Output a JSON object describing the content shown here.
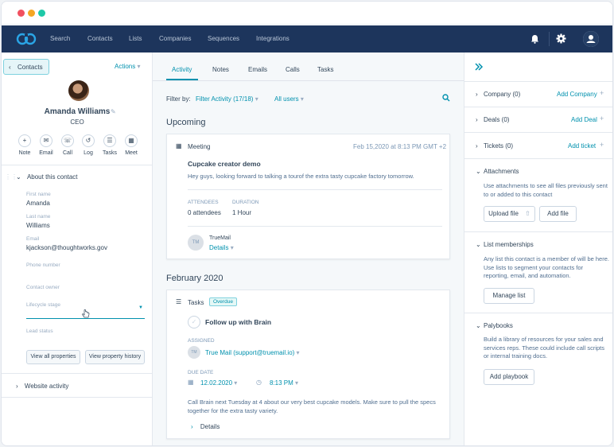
{
  "nav": {
    "items": [
      "Search",
      "Contacts",
      "Lists",
      "Companies",
      "Sequences",
      "Integrations"
    ]
  },
  "left": {
    "contacts_button": "Contacts",
    "actions": "Actions",
    "name": "Amanda Williams",
    "role": "CEO",
    "quick_actions": [
      "Note",
      "Email",
      "Call",
      "Log",
      "Tasks",
      "Meet"
    ],
    "about_title": "About this contact",
    "fields": [
      {
        "label": "First name",
        "value": "Amanda"
      },
      {
        "label": "Last name",
        "value": "Williams"
      },
      {
        "label": "Email",
        "value": "kjackson@thoughtworks.gov"
      },
      {
        "label": "Phone number",
        "value": ""
      },
      {
        "label": "Contact owner",
        "value": ""
      },
      {
        "label": "Lifecycle stage",
        "value": ""
      },
      {
        "label": "Lead status",
        "value": ""
      }
    ],
    "view_all": "View all properties",
    "view_history": "View property history",
    "website_activity": "Website activity"
  },
  "mid": {
    "tabs": [
      "Activity",
      "Notes",
      "Emails",
      "Calls",
      "Tasks"
    ],
    "filter_label": "Filter by:",
    "filter_activity": "Filter Activity (17/18)",
    "filter_users": "All users",
    "upcoming": "Upcoming",
    "meeting": {
      "type": "Meeting",
      "date": "Feb 15,2020 at 8:13 PM GMT +2",
      "title": "Cupcake creator demo",
      "body": "Hey guys, looking forward to talking a tourof the extra tasty cupcake factory tomorrow.",
      "attendees_label": "ATTENDEES",
      "attendees_value": "0 attendees",
      "duration_label": "DURATION",
      "duration_value": "1 Hour",
      "initials": "TM",
      "owner": "TrueMail",
      "details": "Details"
    },
    "february": "February 2020",
    "task": {
      "type": "Tasks",
      "badge": "Overdue",
      "title": "Follow up with Brain",
      "assigned_label": "ASSIGNED",
      "initials": "TM",
      "assignee": "True Mail (support@truemail.io)",
      "due_label": "DUE DATE",
      "due_date": "12.02.2020",
      "due_time": "8:13 PM",
      "body": "Call Brain next Tuesday at 4 about our very best cupcake models. Make sure to pull the specs together for the extra tasty variety.",
      "details": "Details"
    }
  },
  "right": {
    "company": "Company (0)",
    "add_company": "Add Company",
    "deals": "Deals (0)",
    "add_deal": "Add Deal",
    "tickets": "Tickets (0)",
    "add_ticket": "Add ticket",
    "attachments": "Attachments",
    "attachments_body": "Use attachments to see all files previously sent to or added to this contact",
    "upload_file": "Upload file",
    "add_file": "Add file",
    "list_memberships": "List memberships",
    "list_body": "Any list this contact is a member of will be here. Use lists to segment your contacts for reporting, email, and automation.",
    "manage_list": "Manage list",
    "playbooks": "Palybooks",
    "playbooks_body": "Build a library of resources for your sales and services reps. These could include call scripts or internal training docs.",
    "add_playbook": "Add playbook"
  }
}
